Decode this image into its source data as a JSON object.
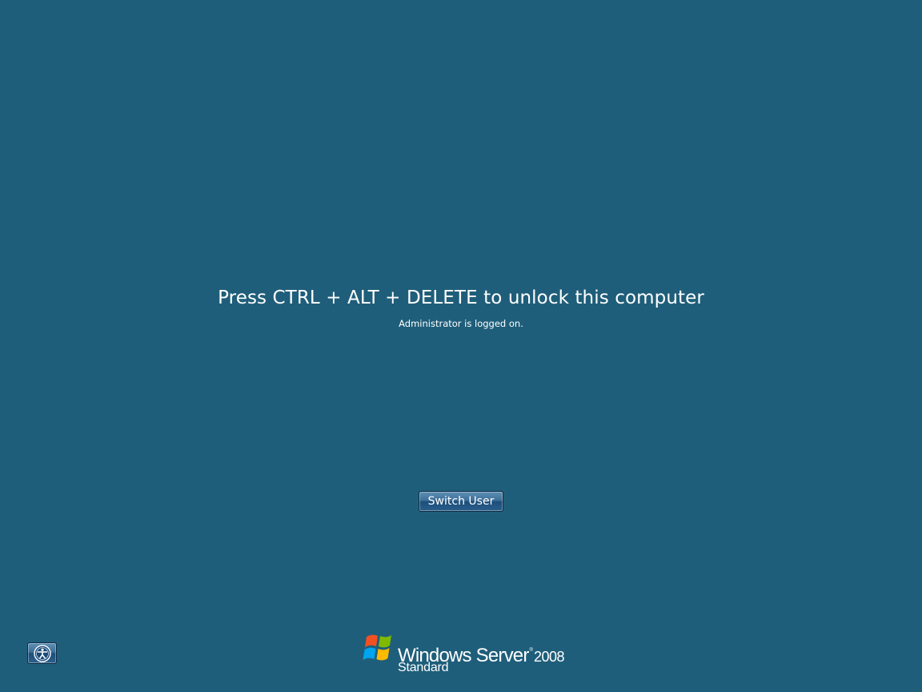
{
  "lock_screen": {
    "headline": "Press CTRL + ALT + DELETE to unlock this computer",
    "status": "Administrator is logged on."
  },
  "actions": {
    "switch_user_label": "Switch User"
  },
  "ease_of_access": {
    "icon": "ease-of-access-icon"
  },
  "branding": {
    "product_name": "Windows Server",
    "trademark": "®",
    "version": "2008",
    "edition": "Standard",
    "logo_icon": "windows-flag-icon"
  },
  "colors": {
    "background": "#1f5e7a",
    "text": "#ffffff",
    "button_top": "#5f8fb5",
    "button_bottom": "#1c4e7a"
  }
}
